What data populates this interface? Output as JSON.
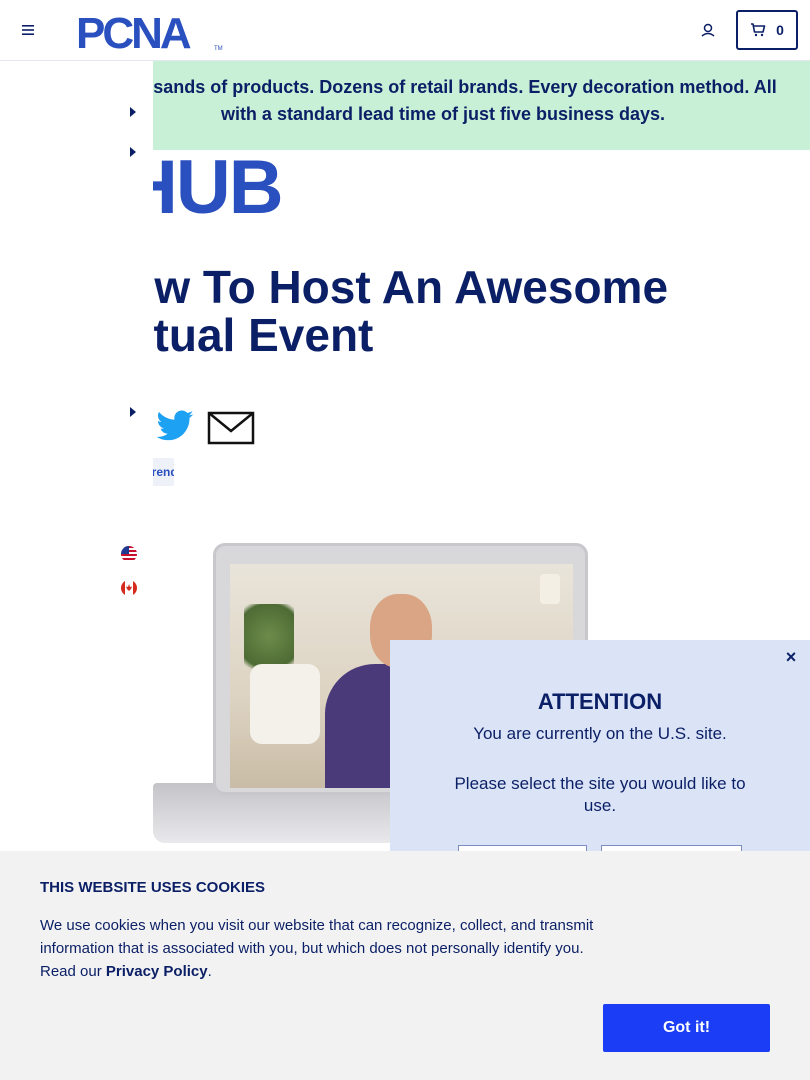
{
  "header": {
    "logo_text": "PCNA",
    "logo_tm": "TM",
    "cart_count": "0"
  },
  "banner": {
    "text": "Thousands of products. Dozens of retail brands. Every decoration method. All with a standard lead time of just five business days."
  },
  "article": {
    "section_logo": "HUB",
    "title": "How To Host An Awesome Virtual Event",
    "tag": "Trends"
  },
  "modal": {
    "close": "×",
    "title": "ATTENTION",
    "line1": "You are currently on the U.S. site.",
    "line2": "Please select the site you would like to use."
  },
  "cookie": {
    "title": "THIS WEBSITE USES COOKIES",
    "text_before": "We use cookies when you visit our website that can recognize, collect, and transmit information that is associated with you, but which does not personally identify you. Read our ",
    "link_label": "Privacy Policy",
    "text_after": ".",
    "button_label": "Got it!"
  },
  "colors": {
    "navy": "#0b1f66",
    "brand_blue": "#2a4fbf",
    "banner_green": "#c8f0d6",
    "modal_bg": "#dbe4f6",
    "button_blue": "#1a3df5"
  }
}
